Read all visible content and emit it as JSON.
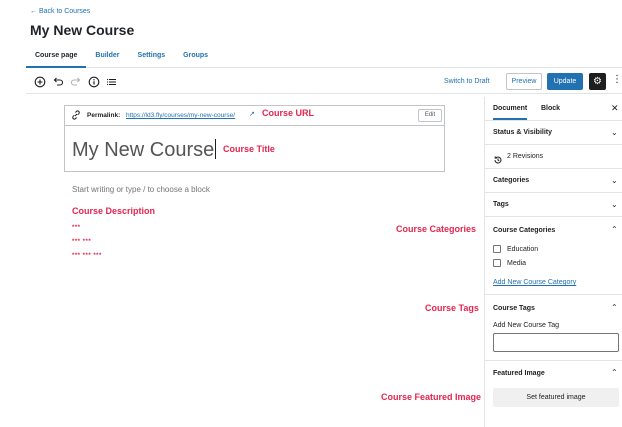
{
  "header": {
    "back_link": "← Back to Courses",
    "title": "My New Course"
  },
  "tabs": [
    {
      "label": "Course page"
    },
    {
      "label": "Builder"
    },
    {
      "label": "Settings"
    },
    {
      "label": "Groups"
    }
  ],
  "toolbar": {
    "switch_draft": "Switch to Draft",
    "preview": "Preview",
    "update": "Update"
  },
  "editor": {
    "permalink_label": "Permalink:",
    "permalink_url": "https://ld3.fly/courses/my-new-course/",
    "edit_label": "Edit",
    "title_value": "My New Course",
    "block_placeholder": "Start writing or type / to choose a block",
    "list_markers": [
      "***",
      "*** ***",
      "*** *** ***"
    ]
  },
  "annotations": {
    "course_url": "Course URL",
    "course_title": "Course Title",
    "course_description": "Course Description",
    "course_categories": "Course Categories",
    "course_tags": "Course Tags",
    "course_featured_image": "Course Featured Image"
  },
  "sidebar": {
    "tab_document": "Document",
    "tab_block": "Block",
    "status_visibility": "Status & Visibility",
    "revisions": "2 Revisions",
    "categories": "Categories",
    "tags": "Tags",
    "course_categories": "Course Categories",
    "category_options": [
      {
        "label": "Education",
        "checked": false
      },
      {
        "label": "Media",
        "checked": false
      }
    ],
    "add_category": "Add New Course Category",
    "course_tags": "Course Tags",
    "add_tag_label": "Add New Course Tag",
    "featured_image": "Featured Image",
    "set_featured": "Set featured image"
  },
  "colors": {
    "accent": "#2271b1",
    "annotation": "#e3254f",
    "dark": "#1e1e1e"
  },
  "icons": {
    "add_block": "plus-circle-icon",
    "undo": "undo-icon",
    "redo": "redo-icon",
    "info": "info-icon",
    "outline": "list-icon",
    "settings": "gear-icon",
    "more": "vertical-dots-icon"
  }
}
